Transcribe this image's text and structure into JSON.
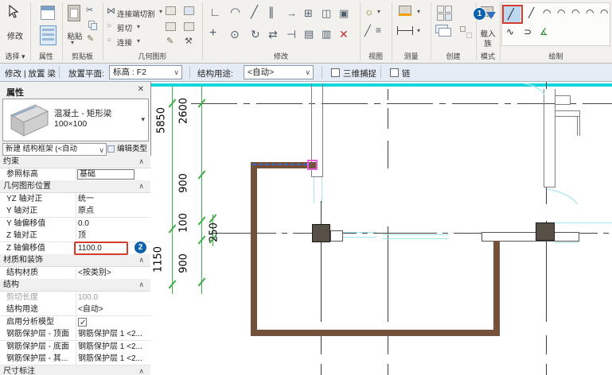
{
  "glyphs": {
    "dropdown": "▾",
    "chevron_down": "∨",
    "collapse": "∧",
    "close": "✕",
    "scissors": "✂",
    "pencil": "✎",
    "hammer": "⚒",
    "bowtie": "⋈",
    "circle": "○",
    "align": "∟",
    "fillet": "◠",
    "split": "╱",
    "parallel": "∥",
    "arrow_right": "→",
    "array": "⊞",
    "mirror": "◫",
    "box": "▣",
    "move": "+",
    "copy": "⊙",
    "rotate": "↻",
    "swap": "⇄",
    "trim": "⊣",
    "shade1": "▤",
    "shade2": "▥",
    "delete": "✕",
    "sun": "☼",
    "lines": "≡",
    "line": "╱",
    "arc": "◠",
    "spline": "∿",
    "ubend": "⊃",
    "angle": "∡",
    "check": "✓"
  },
  "ribbon": {
    "select": {
      "label": "选择 ▾",
      "modify": "修改"
    },
    "properties_label": "属性",
    "clipboard": {
      "label": "剪贴板",
      "paste": "粘贴"
    },
    "geometry": {
      "label": "几何图形",
      "r1": "连接端切割",
      "r2": "剪切",
      "r3": "连接"
    },
    "modify_label": "修改",
    "view_label": "视图",
    "measure_label": "测量",
    "create_label": "创建",
    "mode": {
      "label": "模式",
      "line1": "载入",
      "line2": "族"
    },
    "draw_label": "绘制",
    "badge1": "1"
  },
  "options_bar": {
    "mode_label": "修改 | 放置 梁",
    "placement_plane_label": "放置平面:",
    "placement_plane_value": "标高 : F2",
    "structural_usage_label": "结构用途:",
    "structural_usage_value": "<自动>",
    "snap_3d_label": "三维捕捉",
    "chain_label": "链"
  },
  "properties": {
    "title": "属性",
    "type_line1": "混凝土 - 矩形梁",
    "type_line2": "100×100",
    "selector_value": "新建 结构框架 (<自动",
    "edit_type": "编辑类型",
    "badge2": "2",
    "rows": [
      {
        "section": "约束"
      },
      {
        "label": "参照标高",
        "value": "基础"
      },
      {
        "section": "几何图形位置"
      },
      {
        "label": "YZ 轴对正",
        "value": "统一"
      },
      {
        "label": "Y 轴对正",
        "value": "原点"
      },
      {
        "label": "Y 轴偏移值",
        "value": "0.0"
      },
      {
        "label": "Z 轴对正",
        "value": "顶"
      },
      {
        "label": "Z 轴偏移值",
        "value": "1100.0"
      },
      {
        "section": "材质和装饰"
      },
      {
        "label": "结构材质",
        "value": "<按类别>"
      },
      {
        "section": "结构"
      },
      {
        "label": "剪切长度",
        "value": "100.0"
      },
      {
        "label": "结构用途",
        "value": "<自动>"
      },
      {
        "label": "启用分析模型",
        "value": ""
      },
      {
        "label": "钢筋保护层 - 顶面",
        "value": "钢筋保护层 1 <2..."
      },
      {
        "label": "钢筋保护层 - 底面",
        "value": "钢筋保护层 1 <2..."
      },
      {
        "label": "钢筋保护层 - 其...",
        "value": "钢筋保护层 1 <2..."
      },
      {
        "section": "尺寸标注"
      }
    ]
  },
  "canvas": {
    "dims": {
      "d5850": "5850",
      "d1150": "1150",
      "d2600": "2600",
      "d900a": "900",
      "d100": "100",
      "d900b": "900",
      "d250": "250"
    },
    "badge2": "2"
  },
  "colors": {
    "level_line": "#10d7dc",
    "dimension_green": "#3fae49",
    "beam_brown": "#74513a",
    "badge_blue": "#0d62ad",
    "highlight_red": "#d43b2f",
    "snap_magenta": "#e85fd8",
    "aux_cyan": "#a5e6ee"
  }
}
